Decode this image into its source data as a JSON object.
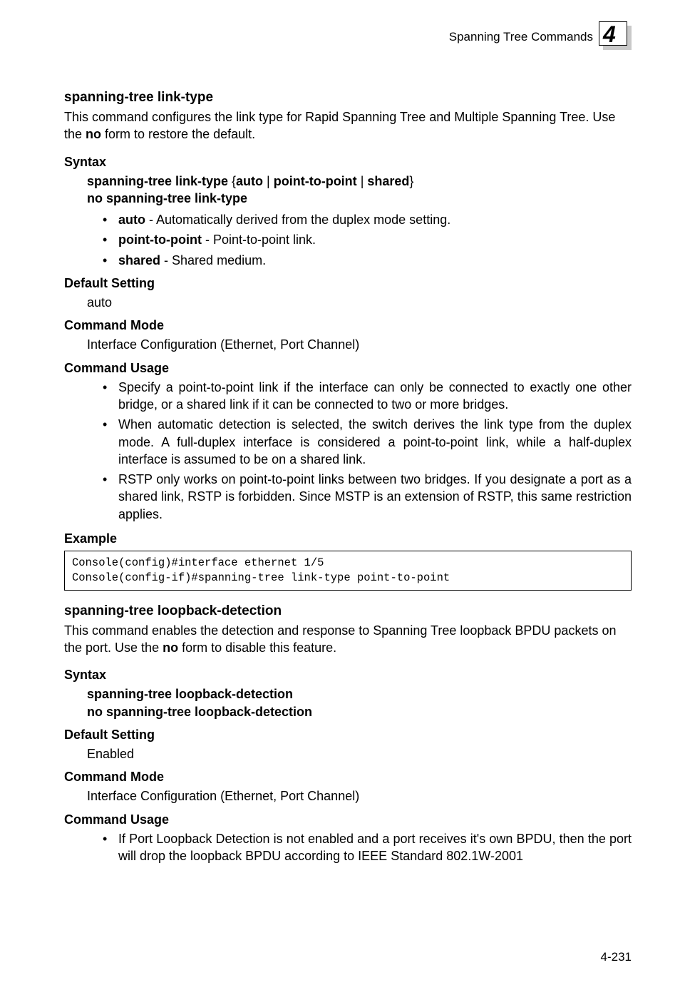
{
  "header": {
    "section": "Spanning Tree Commands",
    "chapter": "4"
  },
  "cmd1": {
    "title": "spanning-tree link-type",
    "desc_pre": "This command configures the link type for Rapid Spanning Tree and Multiple Spanning Tree. Use the ",
    "desc_bold": "no",
    "desc_post": " form to restore the default.",
    "syntax_label": "Syntax",
    "syntax_line1_b1": "spanning-tree link-type",
    "syntax_line1_brace_open": " {",
    "syntax_line1_b2": "auto",
    "syntax_line1_pipe1": " | ",
    "syntax_line1_b3": "point-to-point",
    "syntax_line1_pipe2": " | ",
    "syntax_line1_b4": "shared",
    "syntax_line1_brace_close": "}",
    "syntax_line2": "no spanning-tree link-type",
    "opts": [
      {
        "term": "auto",
        "desc": " - Automatically derived from the duplex mode setting."
      },
      {
        "term": "point-to-point",
        "desc": " - Point-to-point link."
      },
      {
        "term": "shared",
        "desc": " - Shared medium."
      }
    ],
    "default_label": "Default Setting",
    "default_value": "auto",
    "mode_label": "Command Mode",
    "mode_value": "Interface Configuration (Ethernet, Port Channel)",
    "usage_label": "Command Usage",
    "usage": [
      "Specify a point-to-point link if the interface can only be connected to exactly one other bridge, or a shared link if it can be connected to two or more bridges.",
      "When automatic detection is selected, the switch derives the link type from the duplex mode. A full-duplex interface is considered a point-to-point link, while a half-duplex interface is assumed to be on a shared link.",
      "RSTP only works on point-to-point links between two bridges. If you designate a port as a shared link, RSTP is forbidden. Since MSTP is an extension of RSTP, this same restriction applies."
    ],
    "example_label": "Example",
    "example_code": "Console(config)#interface ethernet 1/5\nConsole(config-if)#spanning-tree link-type point-to-point"
  },
  "cmd2": {
    "title": "spanning-tree loopback-detection",
    "desc_pre": "This command enables the detection and response to Spanning Tree loopback BPDU packets on the port. Use the ",
    "desc_bold": "no",
    "desc_post": " form to disable this feature.",
    "syntax_label": "Syntax",
    "syntax_line1": "spanning-tree loopback-detection",
    "syntax_line2": "no spanning-tree loopback-detection",
    "default_label": "Default Setting",
    "default_value": "Enabled",
    "mode_label": "Command Mode",
    "mode_value": "Interface Configuration (Ethernet, Port Channel)",
    "usage_label": "Command Usage",
    "usage": [
      "If Port Loopback Detection is not enabled and a port receives it's own BPDU, then the port will drop the loopback BPDU according to IEEE Standard 802.1W-2001"
    ]
  },
  "footer": {
    "page": "4-231"
  }
}
